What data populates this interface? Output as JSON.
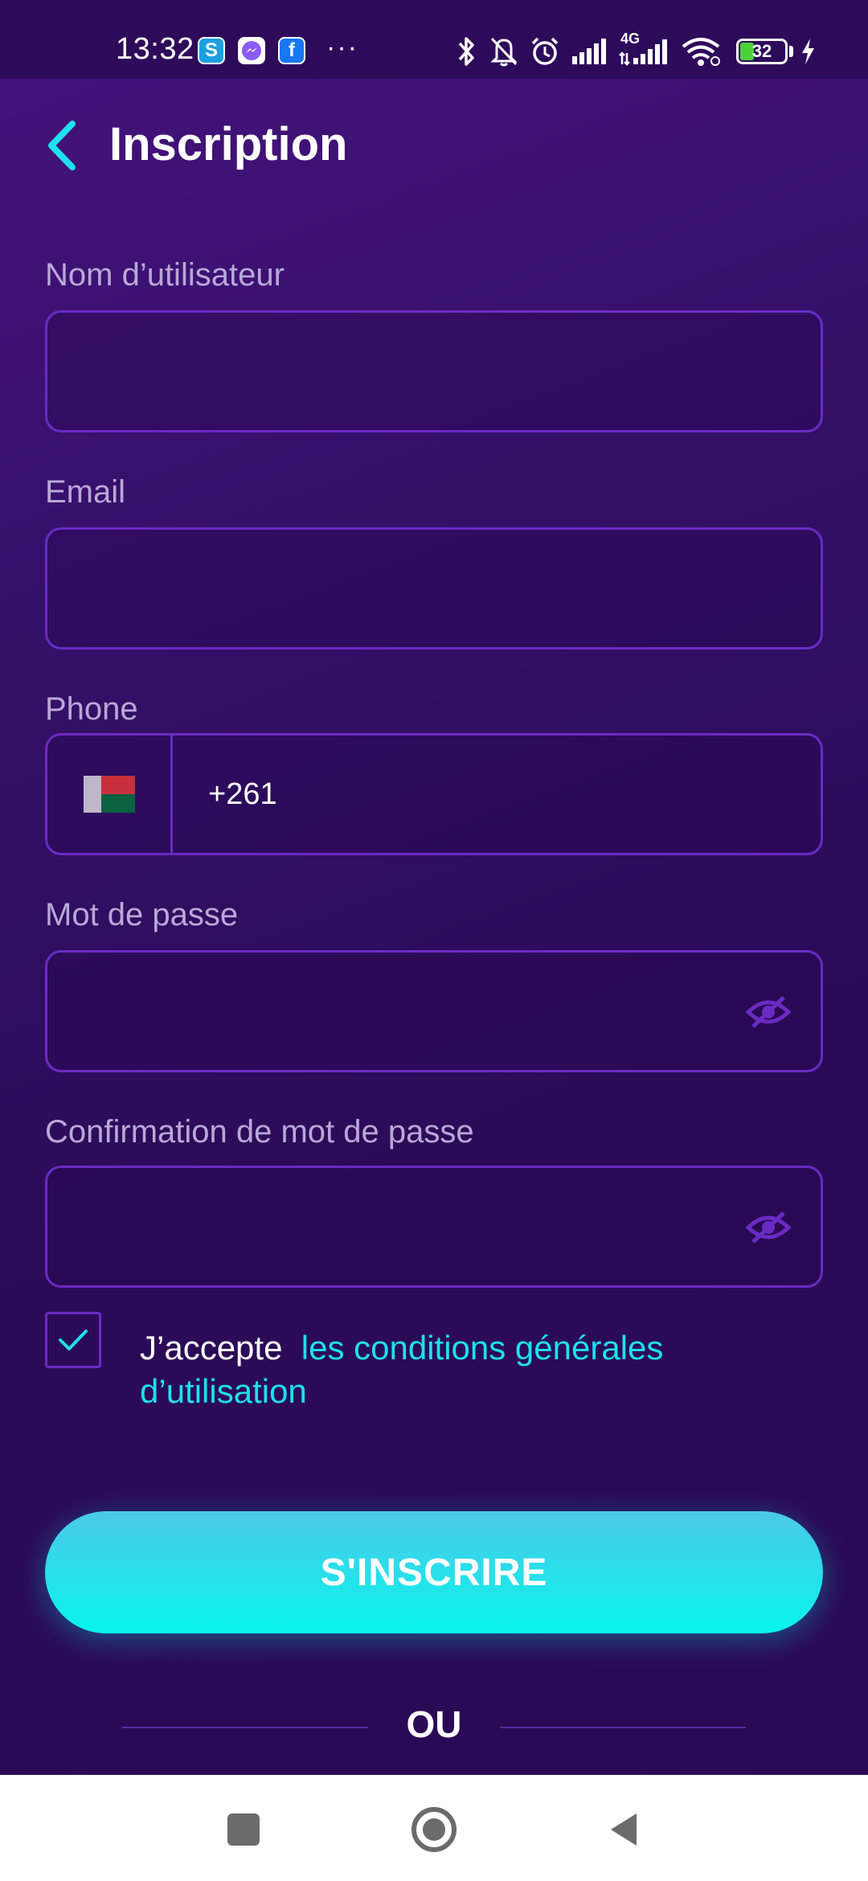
{
  "status_bar": {
    "time": "13:32",
    "notification_icons": [
      "skype-icon",
      "messenger-icon",
      "facebook-icon"
    ],
    "skype_glyph": "S",
    "facebook_glyph": "f",
    "more": "···",
    "system_icons": [
      "bluetooth-icon",
      "bell-off-icon",
      "alarm-icon",
      "signal-icon",
      "4g-signal-icon",
      "wifi-icon"
    ],
    "network_label": "4G",
    "battery_level": "32",
    "battery_fraction": 0.32,
    "charging": true
  },
  "header": {
    "title": "Inscription",
    "back_icon": "chevron-left-icon"
  },
  "form": {
    "username_label": "Nom d’utilisateur",
    "username_value": "",
    "email_label": "Email",
    "email_value": "",
    "phone_label": "Phone",
    "phone_country_flag": "madagascar-flag-icon",
    "phone_code": "+261",
    "password_label": "Mot de passe",
    "password_value": "",
    "confirm_password_label": "Confirmation de mot de passe",
    "confirm_password_value": ""
  },
  "terms": {
    "checked": true,
    "prefix": "J’accepte",
    "link_text": "les conditions générales d’utilisation"
  },
  "submit_label": "S'INSCRIRE",
  "divider_text": "OU",
  "colors": {
    "accent": "#1ee0ee",
    "border": "#6a2bc4",
    "background": "#2e0a5a"
  },
  "nav_bar": {
    "items": [
      "recents-icon",
      "home-icon",
      "back-icon"
    ]
  }
}
